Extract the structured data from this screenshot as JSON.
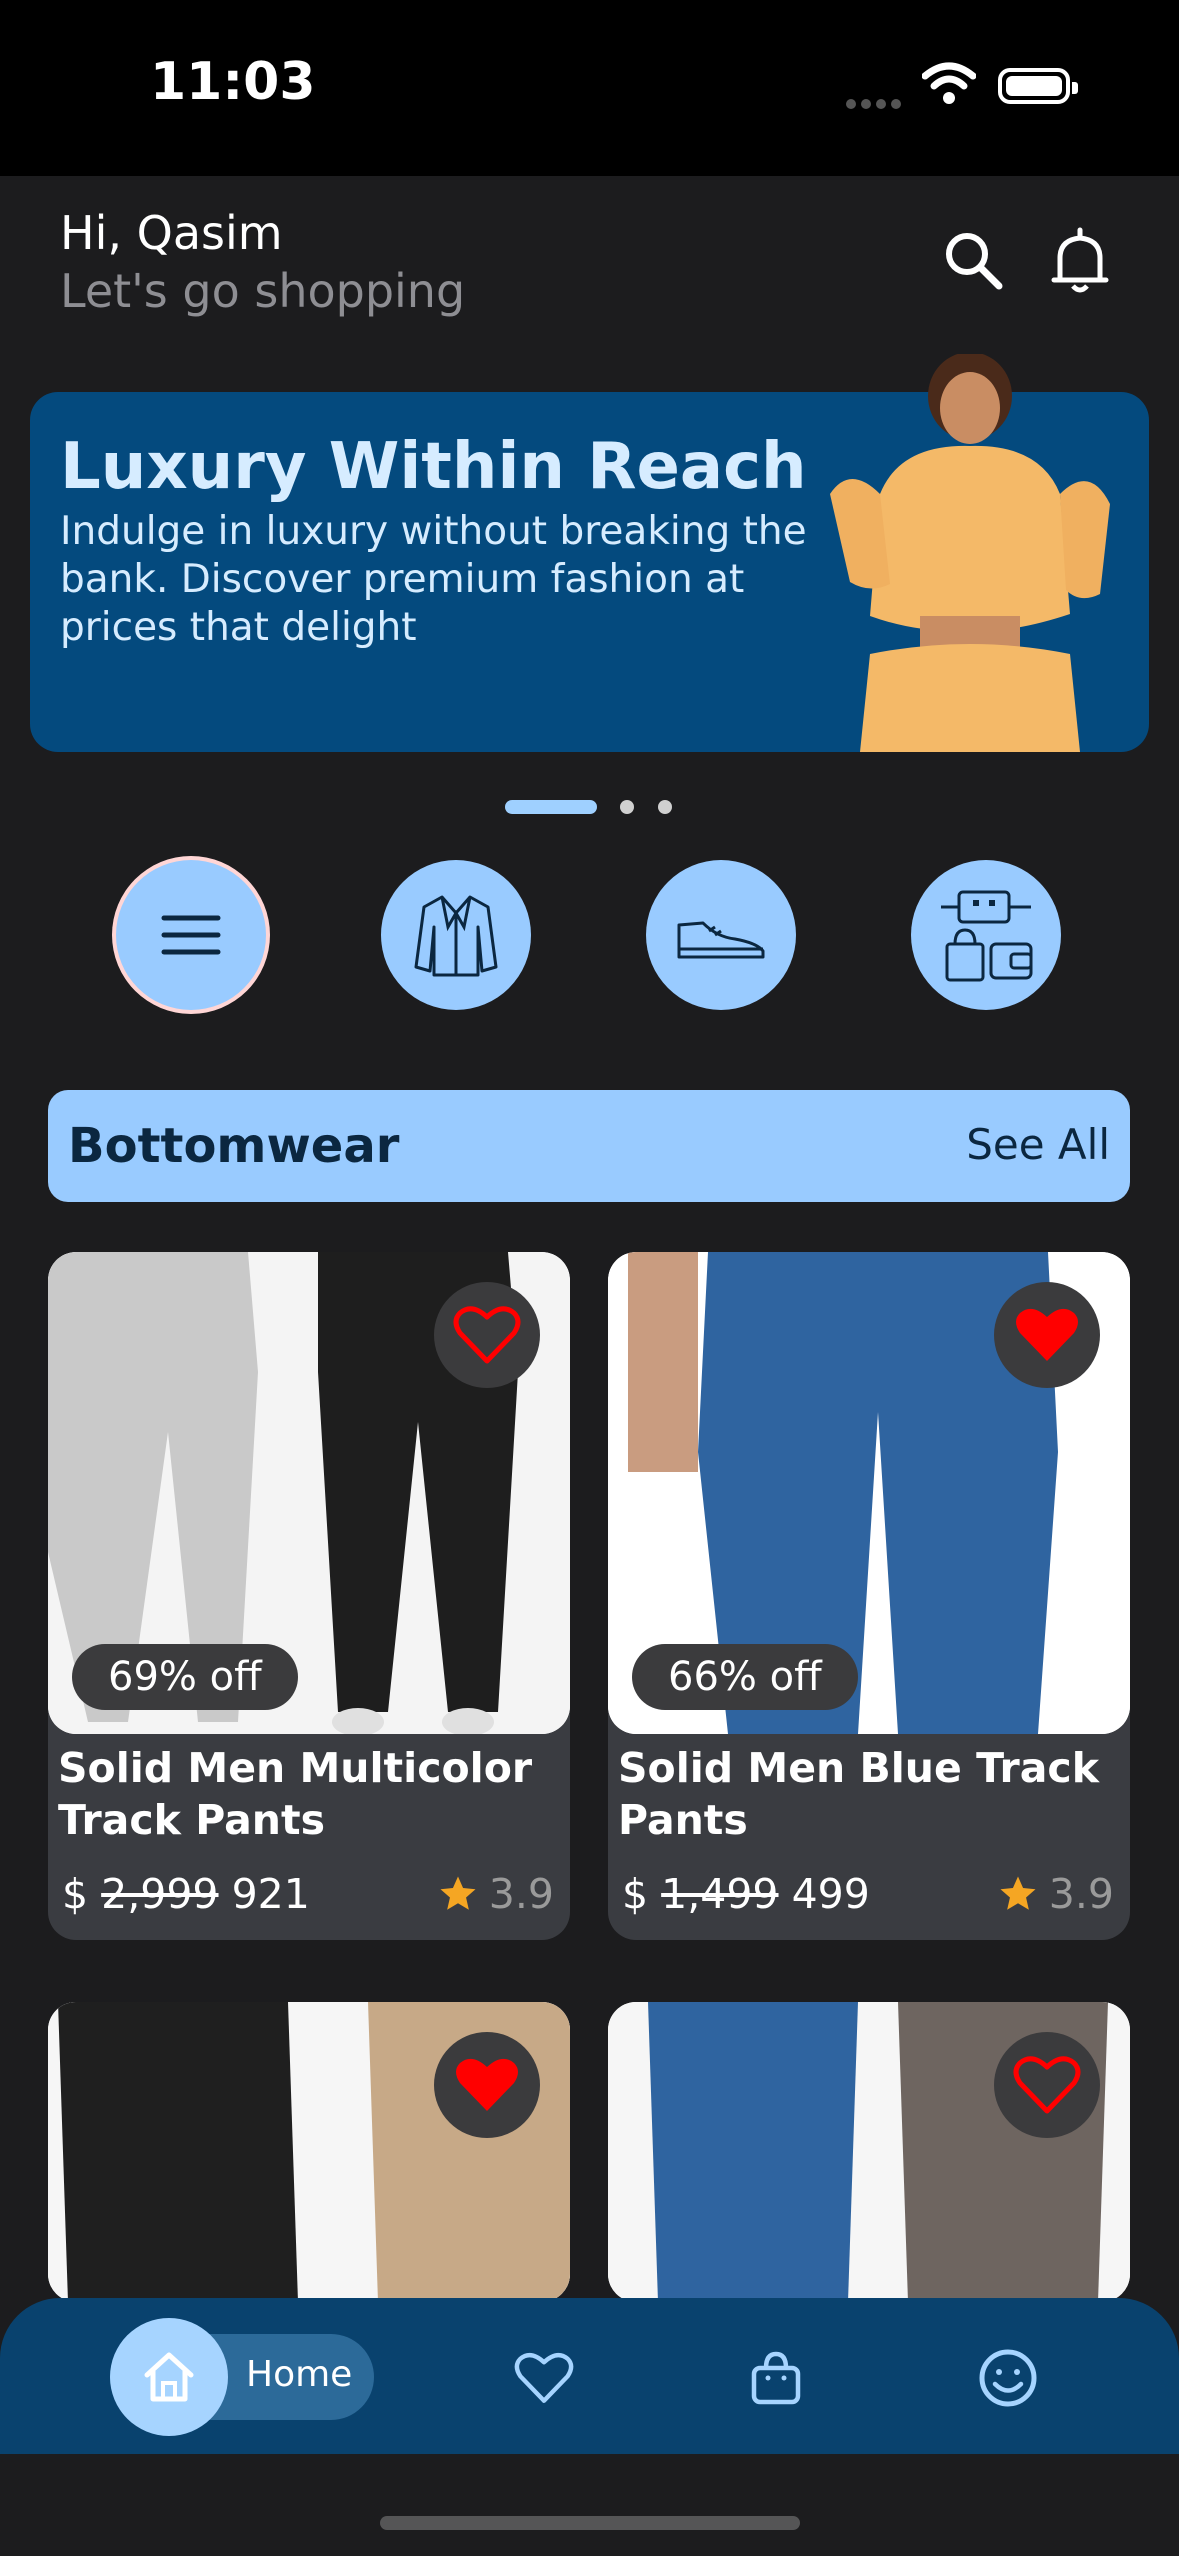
{
  "status_bar": {
    "time": "11:03"
  },
  "header": {
    "greeting": "Hi, Qasim",
    "subtitle": "Let's go shopping"
  },
  "banner": {
    "title": "Luxury Within Reach",
    "text": "Indulge in luxury without breaking the bank. Discover premium fashion at prices that delight",
    "pager": {
      "count": 3,
      "active": 0
    }
  },
  "categories": [
    {
      "icon": "menu-icon",
      "active": true
    },
    {
      "icon": "jacket-icon",
      "active": false
    },
    {
      "icon": "shoe-icon",
      "active": false
    },
    {
      "icon": "accessories-icon",
      "active": false
    }
  ],
  "section": {
    "title": "Bottomwear",
    "see_all": "See All"
  },
  "products": [
    {
      "discount": "69% off",
      "name": "Solid Men Multicolor Track Pants",
      "currency": "$",
      "old_price": "2,999",
      "price": "921",
      "rating": "3.9",
      "favorite": false
    },
    {
      "discount": "66% off",
      "name": "Solid Men Blue Track Pants",
      "currency": "$",
      "old_price": "1,499",
      "price": "499",
      "rating": "3.9",
      "favorite": true
    },
    {
      "favorite": true
    },
    {
      "favorite": false
    }
  ],
  "nav": {
    "home_label": "Home",
    "items": [
      "home-icon",
      "heart-icon",
      "bag-icon",
      "profile-icon"
    ]
  },
  "colors": {
    "accent": "#99cbff",
    "banner": "#044a7e",
    "nav": "#09426e",
    "favorite": "#ff0000",
    "star": "#f5a623"
  }
}
